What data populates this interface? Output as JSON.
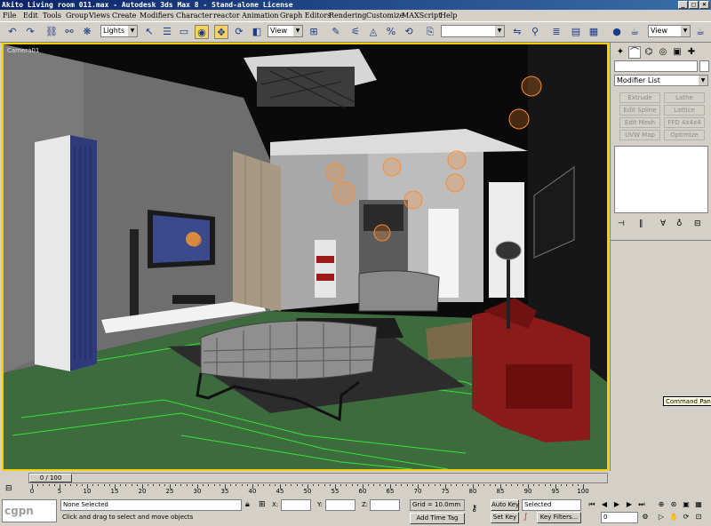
{
  "window": {
    "title": "Akito Living room 011.max - Autodesk 3ds Max 8 - Stand-alone License"
  },
  "menu": [
    "File",
    "Edit",
    "Tools",
    "Group",
    "Views",
    "Create",
    "Modifiers",
    "Character",
    "reactor",
    "Animation",
    "Graph Editors",
    "Rendering",
    "Customize",
    "MAXScript",
    "Help"
  ],
  "toolbar": {
    "selection_filter": "Lights",
    "ref_coord": "View",
    "named_sel": "",
    "view_dd": "View"
  },
  "viewport": {
    "label": "Camera01"
  },
  "command_panel": {
    "modifier_list": "Modifier List",
    "buttons": [
      "Extrude",
      "Lathe",
      "Edit Spline",
      "Lattice",
      "Edit Mesh",
      "FFD 4x4x4",
      "UVW Map",
      "Optimize"
    ],
    "tooltip": "Command Panel"
  },
  "timeline": {
    "frame_label": "0 / 100",
    "ticks": [
      "0",
      "5",
      "10",
      "15",
      "20",
      "25",
      "30",
      "35",
      "40",
      "45",
      "50",
      "55",
      "60",
      "65",
      "70",
      "75",
      "80",
      "85",
      "90",
      "95",
      "100"
    ]
  },
  "status": {
    "logo": "cgpn",
    "selection": "None Selected",
    "prompt": "Click and drag to select and move objects",
    "x_label": "X:",
    "y_label": "Y:",
    "z_label": "Z:",
    "grid": "Grid = 10.0mm",
    "add_time_tag": "Add Time Tag",
    "auto_key": "Auto Key",
    "set_key": "Set Key",
    "key_mode": "Selected",
    "key_filters": "Key Filters...",
    "frame": "0"
  },
  "colors": {
    "viewport_border": "#f5d000",
    "titlebar": "#0a246a",
    "auto_key_active": "#f7d35c"
  }
}
